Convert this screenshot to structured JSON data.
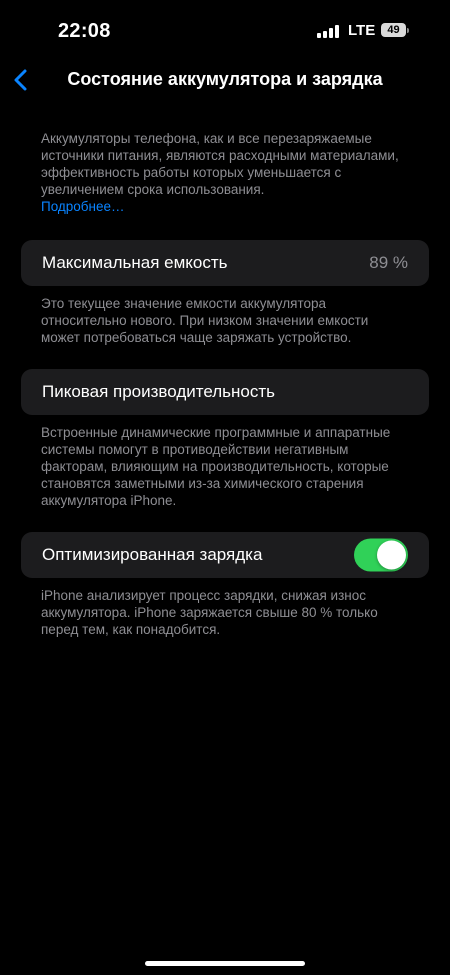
{
  "status_bar": {
    "time": "22:08",
    "network": "LTE",
    "battery_level": "49"
  },
  "nav": {
    "title": "Состояние аккумулятора и зарядка",
    "back_icon": "chevron-left-icon"
  },
  "intro": {
    "text": "Аккумуляторы телефона, как и все перезаряжаемые источники питания, являются расходными материалами, эффективность работы которых уменьшается с увеличением срока использования.",
    "link": "Подробнее…"
  },
  "max_capacity": {
    "label": "Максимальная емкость",
    "value": "89 %",
    "footnote": "Это текущее значение емкости аккумулятора относительно нового. При низком значении емкости может потребоваться чаще заряжать устройство."
  },
  "peak_performance": {
    "label": "Пиковая производительность",
    "footnote": "Встроенные динамические программные и аппаратные системы помогут в противодействии негативным факторам, влияющим на производительность, которые становятся заметными из-за химического старения аккумулятора iPhone."
  },
  "optimized_charging": {
    "label": "Оптимизированная зарядка",
    "enabled": true,
    "footnote": "iPhone анализирует процесс зарядки, снижая износ аккумулятора. iPhone заряжается свыше 80 % только перед тем, как понадобится."
  },
  "colors": {
    "accent": "#0a84ff",
    "toggle_on": "#30d158",
    "cell_bg": "#1c1c1e",
    "secondary_text": "#8e8e93"
  }
}
